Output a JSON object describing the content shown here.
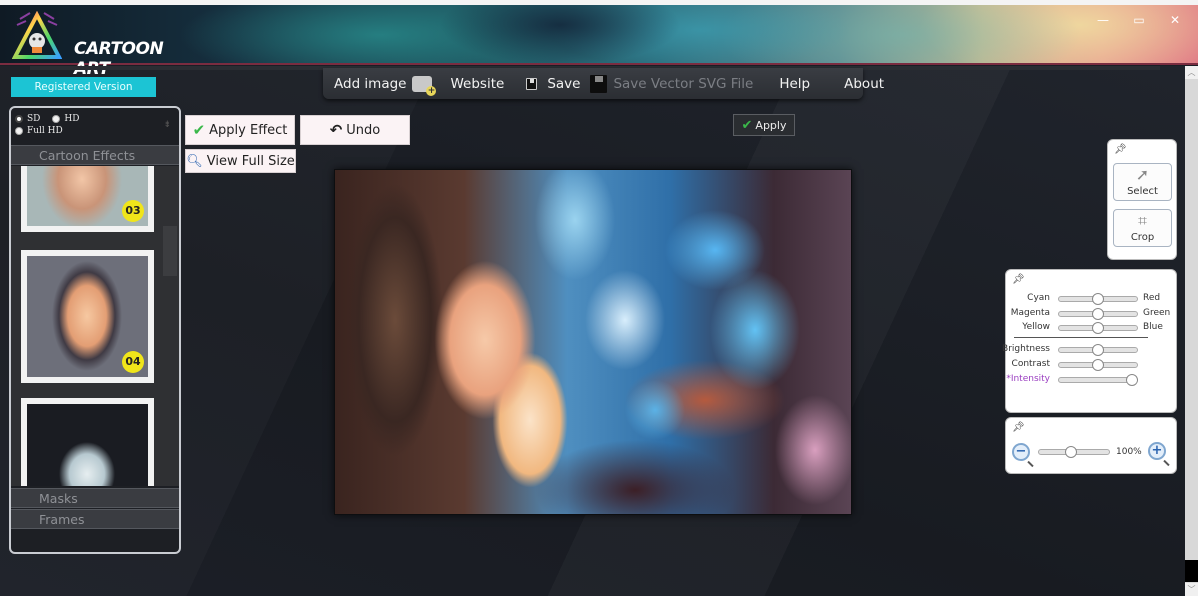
{
  "app": {
    "title": "CARTOON ART",
    "window_controls": {
      "minimize": "—",
      "maximize": "▭",
      "close": "✕"
    }
  },
  "registration": {
    "label": "Registered Version"
  },
  "menu": {
    "items": [
      {
        "label": "Add image",
        "icon": "add-image-icon",
        "enabled": true
      },
      {
        "label": "Website",
        "enabled": true
      },
      {
        "label": "Save",
        "icon": "floppy-icon",
        "enabled": true
      },
      {
        "label": "Save Vector SVG File",
        "icon": "floppy-icon",
        "enabled": false
      },
      {
        "label": "Help",
        "enabled": true
      },
      {
        "label": "About",
        "enabled": true
      }
    ]
  },
  "sidebar": {
    "resolution": {
      "options": [
        "SD",
        "HD",
        "Full HD"
      ],
      "selected": "SD"
    },
    "sections": [
      "Cartoon Effects",
      "Masks",
      "Frames"
    ],
    "effects": [
      {
        "number": "03"
      },
      {
        "number": "04"
      },
      {
        "number": ""
      }
    ]
  },
  "actions": {
    "apply_effect": "Apply Effect",
    "undo": "Undo",
    "view_full_size": "View Full Size",
    "apply": "Apply"
  },
  "tools": {
    "select": "Select",
    "crop": "Crop"
  },
  "adjustments": {
    "color_balance": [
      {
        "left": "Cyan",
        "right": "Red",
        "value": 0.5
      },
      {
        "left": "Magenta",
        "right": "Green",
        "value": 0.5
      },
      {
        "left": "Yellow",
        "right": "Blue",
        "value": 0.5
      }
    ],
    "tone": [
      {
        "label": "Brightness",
        "value": 0.5
      },
      {
        "label": "Contrast",
        "value": 0.5
      },
      {
        "label": "*Intensity",
        "value": 0.93,
        "color": "#9b3fc1"
      }
    ]
  },
  "zoom": {
    "value_label": "100%",
    "value": 0.45
  },
  "colors": {
    "accent": "#1cc4d4",
    "badge": "#f0e51a",
    "check": "#3ab84a",
    "intensity_label": "#9b3fc1"
  }
}
